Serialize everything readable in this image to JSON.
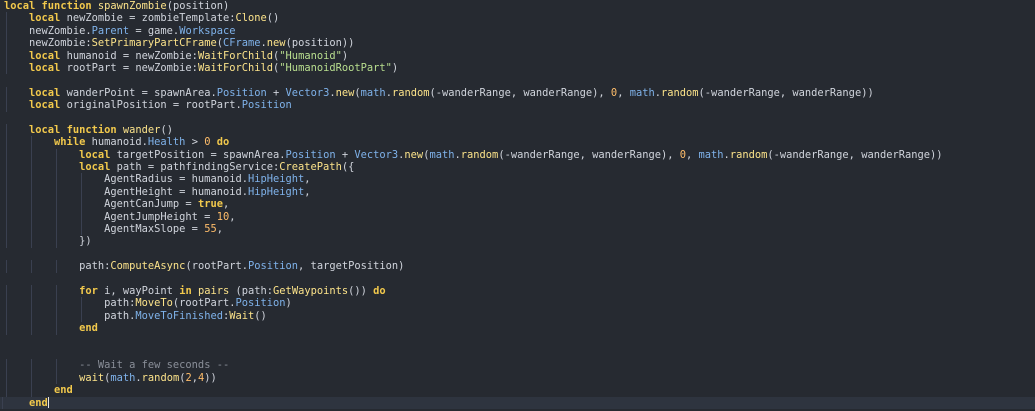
{
  "editor": {
    "colors": {
      "background": "#262a31",
      "current_line": "#2e343f",
      "keyword": "#f2c94c",
      "function": "#fce38a",
      "property": "#7fb2ea",
      "string": "#b9df8f",
      "number": "#ffbd6a",
      "comment": "#8a8f99",
      "text": "#d0d4dc"
    },
    "cursor_line": 32,
    "lines": [
      [
        [
          "kw",
          "local"
        ],
        [
          "id",
          " "
        ],
        [
          "kw",
          "function"
        ],
        [
          "id",
          " "
        ],
        [
          "fn",
          "spawnZombie"
        ],
        [
          "id",
          "(position)"
        ]
      ],
      [
        [
          "id",
          "    "
        ],
        [
          "kw",
          "local"
        ],
        [
          "id",
          " newZombie = zombieTemplate:"
        ],
        [
          "fn",
          "Clone"
        ],
        [
          "id",
          "()"
        ]
      ],
      [
        [
          "id",
          "    newZombie."
        ],
        [
          "prop",
          "Parent"
        ],
        [
          "id",
          " = game."
        ],
        [
          "prop",
          "Workspace"
        ]
      ],
      [
        [
          "id",
          "    newZombie:"
        ],
        [
          "fn",
          "SetPrimaryPartCFrame"
        ],
        [
          "id",
          "("
        ],
        [
          "prop",
          "CFrame"
        ],
        [
          "id",
          "."
        ],
        [
          "fn",
          "new"
        ],
        [
          "id",
          "(position))"
        ]
      ],
      [
        [
          "id",
          "    "
        ],
        [
          "kw",
          "local"
        ],
        [
          "id",
          " humanoid = newZombie:"
        ],
        [
          "fn",
          "WaitForChild"
        ],
        [
          "id",
          "("
        ],
        [
          "str",
          "\"Humanoid\""
        ],
        [
          "id",
          ")"
        ]
      ],
      [
        [
          "id",
          "    "
        ],
        [
          "kw",
          "local"
        ],
        [
          "id",
          " rootPart = newZombie:"
        ],
        [
          "fn",
          "WaitForChild"
        ],
        [
          "id",
          "("
        ],
        [
          "str",
          "\"HumanoidRootPart\""
        ],
        [
          "id",
          ")"
        ]
      ],
      [],
      [
        [
          "id",
          "    "
        ],
        [
          "kw",
          "local"
        ],
        [
          "id",
          " wanderPoint = spawnArea."
        ],
        [
          "prop",
          "Position"
        ],
        [
          "id",
          " + "
        ],
        [
          "prop",
          "Vector3"
        ],
        [
          "id",
          "."
        ],
        [
          "fn",
          "new"
        ],
        [
          "id",
          "("
        ],
        [
          "prop",
          "math"
        ],
        [
          "id",
          "."
        ],
        [
          "fn",
          "random"
        ],
        [
          "id",
          "(-wanderRange, wanderRange), "
        ],
        [
          "num",
          "0"
        ],
        [
          "id",
          ", "
        ],
        [
          "prop",
          "math"
        ],
        [
          "id",
          "."
        ],
        [
          "fn",
          "random"
        ],
        [
          "id",
          "(-wanderRange, wanderRange))"
        ]
      ],
      [
        [
          "id",
          "    "
        ],
        [
          "kw",
          "local"
        ],
        [
          "id",
          " originalPosition = rootPart."
        ],
        [
          "prop",
          "Position"
        ]
      ],
      [],
      [
        [
          "id",
          "    "
        ],
        [
          "kw",
          "local"
        ],
        [
          "id",
          " "
        ],
        [
          "kw",
          "function"
        ],
        [
          "id",
          " "
        ],
        [
          "fn",
          "wander"
        ],
        [
          "id",
          "()"
        ]
      ],
      [
        [
          "id",
          "        "
        ],
        [
          "kw",
          "while"
        ],
        [
          "id",
          " humanoid."
        ],
        [
          "prop",
          "Health"
        ],
        [
          "id",
          " > "
        ],
        [
          "num",
          "0"
        ],
        [
          "id",
          " "
        ],
        [
          "kw",
          "do"
        ]
      ],
      [
        [
          "id",
          "            "
        ],
        [
          "kw",
          "local"
        ],
        [
          "id",
          " targetPosition = spawnArea."
        ],
        [
          "prop",
          "Position"
        ],
        [
          "id",
          " + "
        ],
        [
          "prop",
          "Vector3"
        ],
        [
          "id",
          "."
        ],
        [
          "fn",
          "new"
        ],
        [
          "id",
          "("
        ],
        [
          "prop",
          "math"
        ],
        [
          "id",
          "."
        ],
        [
          "fn",
          "random"
        ],
        [
          "id",
          "(-wanderRange, wanderRange), "
        ],
        [
          "num",
          "0"
        ],
        [
          "id",
          ", "
        ],
        [
          "prop",
          "math"
        ],
        [
          "id",
          "."
        ],
        [
          "fn",
          "random"
        ],
        [
          "id",
          "(-wanderRange, wanderRange))"
        ]
      ],
      [
        [
          "id",
          "            "
        ],
        [
          "kw",
          "local"
        ],
        [
          "id",
          " path = pathfindingService:"
        ],
        [
          "fn",
          "CreatePath"
        ],
        [
          "id",
          "({"
        ]
      ],
      [
        [
          "id",
          "                AgentRadius = humanoid."
        ],
        [
          "prop",
          "HipHeight"
        ],
        [
          "id",
          ","
        ]
      ],
      [
        [
          "id",
          "                AgentHeight = humanoid."
        ],
        [
          "prop",
          "HipHeight"
        ],
        [
          "id",
          ","
        ]
      ],
      [
        [
          "id",
          "                AgentCanJump = "
        ],
        [
          "bool",
          "true"
        ],
        [
          "id",
          ","
        ]
      ],
      [
        [
          "id",
          "                AgentJumpHeight = "
        ],
        [
          "num",
          "10"
        ],
        [
          "id",
          ","
        ]
      ],
      [
        [
          "id",
          "                AgentMaxSlope = "
        ],
        [
          "num",
          "55"
        ],
        [
          "id",
          ","
        ]
      ],
      [
        [
          "id",
          "            })"
        ]
      ],
      [],
      [
        [
          "id",
          "            path:"
        ],
        [
          "fn",
          "ComputeAsync"
        ],
        [
          "id",
          "(rootPart."
        ],
        [
          "prop",
          "Position"
        ],
        [
          "id",
          ", targetPosition)"
        ]
      ],
      [],
      [
        [
          "id",
          "            "
        ],
        [
          "kw",
          "for"
        ],
        [
          "id",
          " i, wayPoint "
        ],
        [
          "kw",
          "in"
        ],
        [
          "id",
          " "
        ],
        [
          "fn",
          "pairs"
        ],
        [
          "id",
          " (path:"
        ],
        [
          "fn",
          "GetWaypoints"
        ],
        [
          "id",
          "()) "
        ],
        [
          "kw",
          "do"
        ]
      ],
      [
        [
          "id",
          "                path:"
        ],
        [
          "fn",
          "MoveTo"
        ],
        [
          "id",
          "(rootPart."
        ],
        [
          "prop",
          "Position"
        ],
        [
          "id",
          ")"
        ]
      ],
      [
        [
          "id",
          "                path."
        ],
        [
          "prop",
          "MoveToFinished"
        ],
        [
          "id",
          ":"
        ],
        [
          "fn",
          "Wait"
        ],
        [
          "id",
          "()"
        ]
      ],
      [
        [
          "id",
          "            "
        ],
        [
          "kw",
          "end"
        ]
      ],
      [],
      [],
      [
        [
          "id",
          "            "
        ],
        [
          "cmt",
          "-- Wait a few seconds --"
        ]
      ],
      [
        [
          "id",
          "            "
        ],
        [
          "fn",
          "wait"
        ],
        [
          "id",
          "("
        ],
        [
          "prop",
          "math"
        ],
        [
          "id",
          "."
        ],
        [
          "fn",
          "random"
        ],
        [
          "id",
          "("
        ],
        [
          "num",
          "2"
        ],
        [
          "id",
          ","
        ],
        [
          "num",
          "4"
        ],
        [
          "id",
          "))"
        ]
      ],
      [
        [
          "id",
          "        "
        ],
        [
          "kw",
          "end"
        ]
      ],
      [
        [
          "id",
          "    "
        ],
        [
          "kw",
          "end"
        ]
      ]
    ]
  }
}
